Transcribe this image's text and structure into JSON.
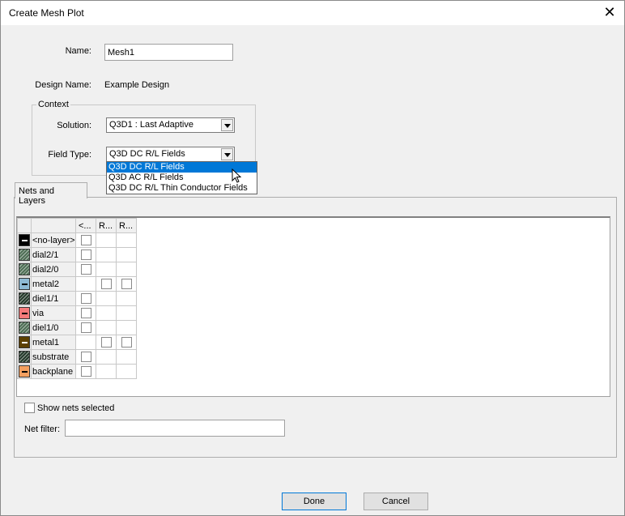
{
  "window": {
    "title": "Create Mesh Plot"
  },
  "form": {
    "name_label": "Name:",
    "name_value": "Mesh1",
    "design_name_label": "Design Name:",
    "design_name_value": "Example Design"
  },
  "context": {
    "label": "Context",
    "solution_label": "Solution:",
    "solution_value": "Q3D1 : Last Adaptive",
    "field_type_label": "Field Type:",
    "field_type_value": "Q3D DC R/L Fields",
    "field_type_options": [
      "Q3D DC R/L Fields",
      "Q3D AC R/L Fields",
      "Q3D DC R/L Thin Conductor Fields"
    ],
    "field_type_highlighted": "Q3D DC R/L Fields"
  },
  "tabs": [
    {
      "label": "Nets and Layers",
      "active": true
    }
  ],
  "grid": {
    "columns": [
      "<...",
      "R...",
      "R..."
    ],
    "rows": [
      {
        "name": "<no-layer>",
        "color": "#000000",
        "hatch": false,
        "bar": "#ffffff",
        "checks": [
          true,
          false,
          false
        ]
      },
      {
        "name": "dial2/1",
        "color": "#4e6e55",
        "hatch": true,
        "bar": "",
        "checks": [
          true,
          false,
          false
        ]
      },
      {
        "name": "dial2/0",
        "color": "#4e6e55",
        "hatch": true,
        "bar": "",
        "checks": [
          true,
          false,
          false
        ]
      },
      {
        "name": "metal2",
        "color": "#8db9d4",
        "hatch": false,
        "bar": "#000000",
        "checks": [
          false,
          true,
          true
        ]
      },
      {
        "name": "diel1/1",
        "color": "#253a2b",
        "hatch": true,
        "bar": "",
        "checks": [
          true,
          false,
          false
        ]
      },
      {
        "name": "via",
        "color": "#f47a7a",
        "hatch": false,
        "bar": "#000000",
        "checks": [
          true,
          false,
          false
        ]
      },
      {
        "name": "diel1/0",
        "color": "#4e6e55",
        "hatch": true,
        "bar": "",
        "checks": [
          true,
          false,
          false
        ]
      },
      {
        "name": "metal1",
        "color": "#5c4000",
        "hatch": false,
        "bar": "#ffffff",
        "checks": [
          false,
          true,
          true
        ]
      },
      {
        "name": "substrate",
        "color": "#253a2b",
        "hatch": true,
        "bar": "",
        "checks": [
          true,
          false,
          false
        ]
      },
      {
        "name": "backplane",
        "color": "#f4a060",
        "hatch": false,
        "bar": "#000000",
        "checks": [
          true,
          false,
          false
        ]
      }
    ]
  },
  "options": {
    "show_nets_label": "Show nets selected",
    "show_nets_checked": false,
    "net_filter_label": "Net filter:",
    "net_filter_value": ""
  },
  "buttons": {
    "done": "Done",
    "cancel": "Cancel"
  }
}
